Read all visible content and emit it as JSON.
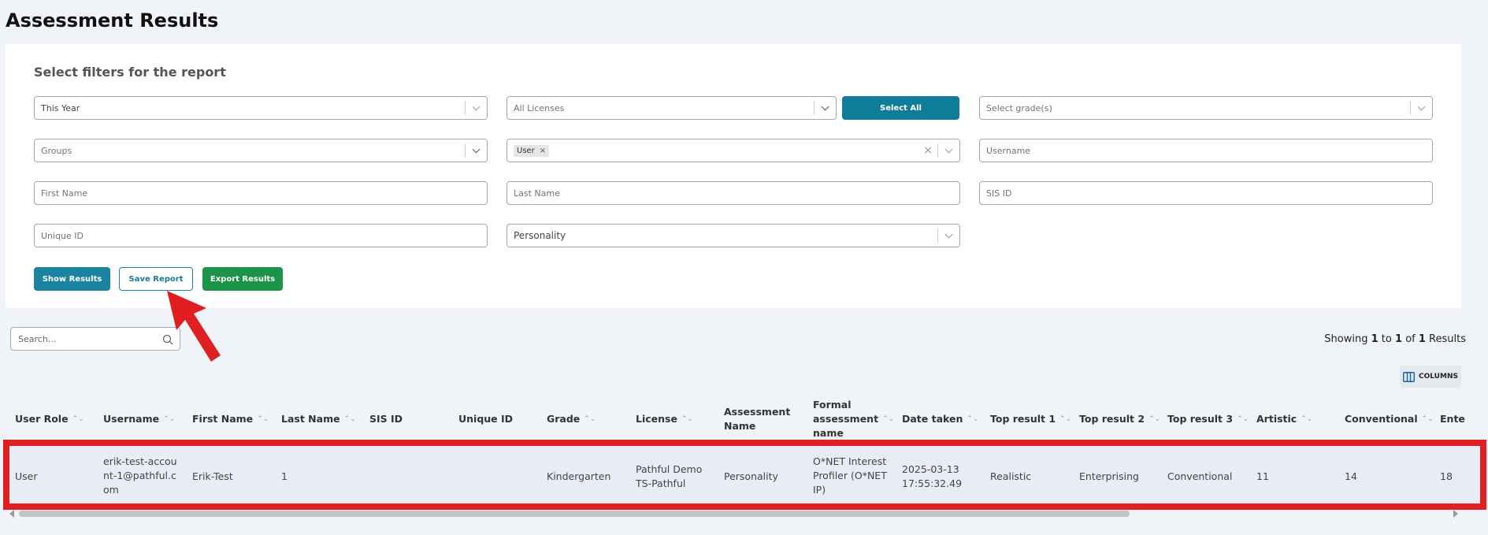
{
  "page": {
    "title": "Assessment Results"
  },
  "filters": {
    "heading": "Select filters for the report",
    "date_range": "This Year",
    "licenses": "All Licenses",
    "select_all_label": "Select All",
    "grade_placeholder": "Select grade(s)",
    "groups": "Groups",
    "role_tag": "User",
    "tag_remove": "×",
    "clear_symbol": "×",
    "username_placeholder": "Username",
    "first_name_placeholder": "First Name",
    "last_name_placeholder": "Last Name",
    "sis_id_placeholder": "SIS ID",
    "unique_id_placeholder": "Unique ID",
    "assessment_type": "Personality"
  },
  "actions": {
    "show_results": "Show Results",
    "save_report": "Save Report",
    "export_results": "Export Results"
  },
  "table_controls": {
    "search_placeholder": "Search...",
    "showing_prefix": "Showing",
    "showing_from": "1",
    "showing_to_word": "to",
    "showing_to": "1",
    "showing_of_word": "of",
    "showing_total": "1",
    "showing_suffix": "Results",
    "columns_label": "COLUMNS"
  },
  "table": {
    "sort_glyph": "⌃⌄",
    "headers": {
      "user_role": "User Role",
      "username": "Username",
      "first_name": "First Name",
      "last_name": "Last Name",
      "sis_id": "SIS ID",
      "unique_id": "Unique ID",
      "grade": "Grade",
      "license": "License",
      "assessment_name": "Assessment Name",
      "formal_name": "Formal assessment name",
      "date_taken": "Date taken",
      "top1": "Top result 1",
      "top2": "Top result 2",
      "top3": "Top result 3",
      "artistic": "Artistic",
      "conventional": "Conventional",
      "enterprising": "Ente"
    },
    "row": {
      "user_role": "User",
      "username": "erik-test-account-1@pathful.com",
      "first_name": "Erik-Test",
      "last_name": "1",
      "sis_id": "",
      "unique_id": "",
      "grade": "Kindergarten",
      "license": "Pathful Demo TS-Pathful",
      "assessment_name": "Personality",
      "formal_name": "O*NET Interest Profiler (O*NET IP)",
      "date_taken": "2025-03-13 17:55:32.49",
      "top1": "Realistic",
      "top2": "Enterprising",
      "top3": "Conventional",
      "artistic": "11",
      "conventional": "14",
      "enterprising": "18"
    }
  },
  "colors": {
    "teal": "#1a84a0",
    "green": "#1b9447",
    "annotation_red": "#e02020"
  }
}
